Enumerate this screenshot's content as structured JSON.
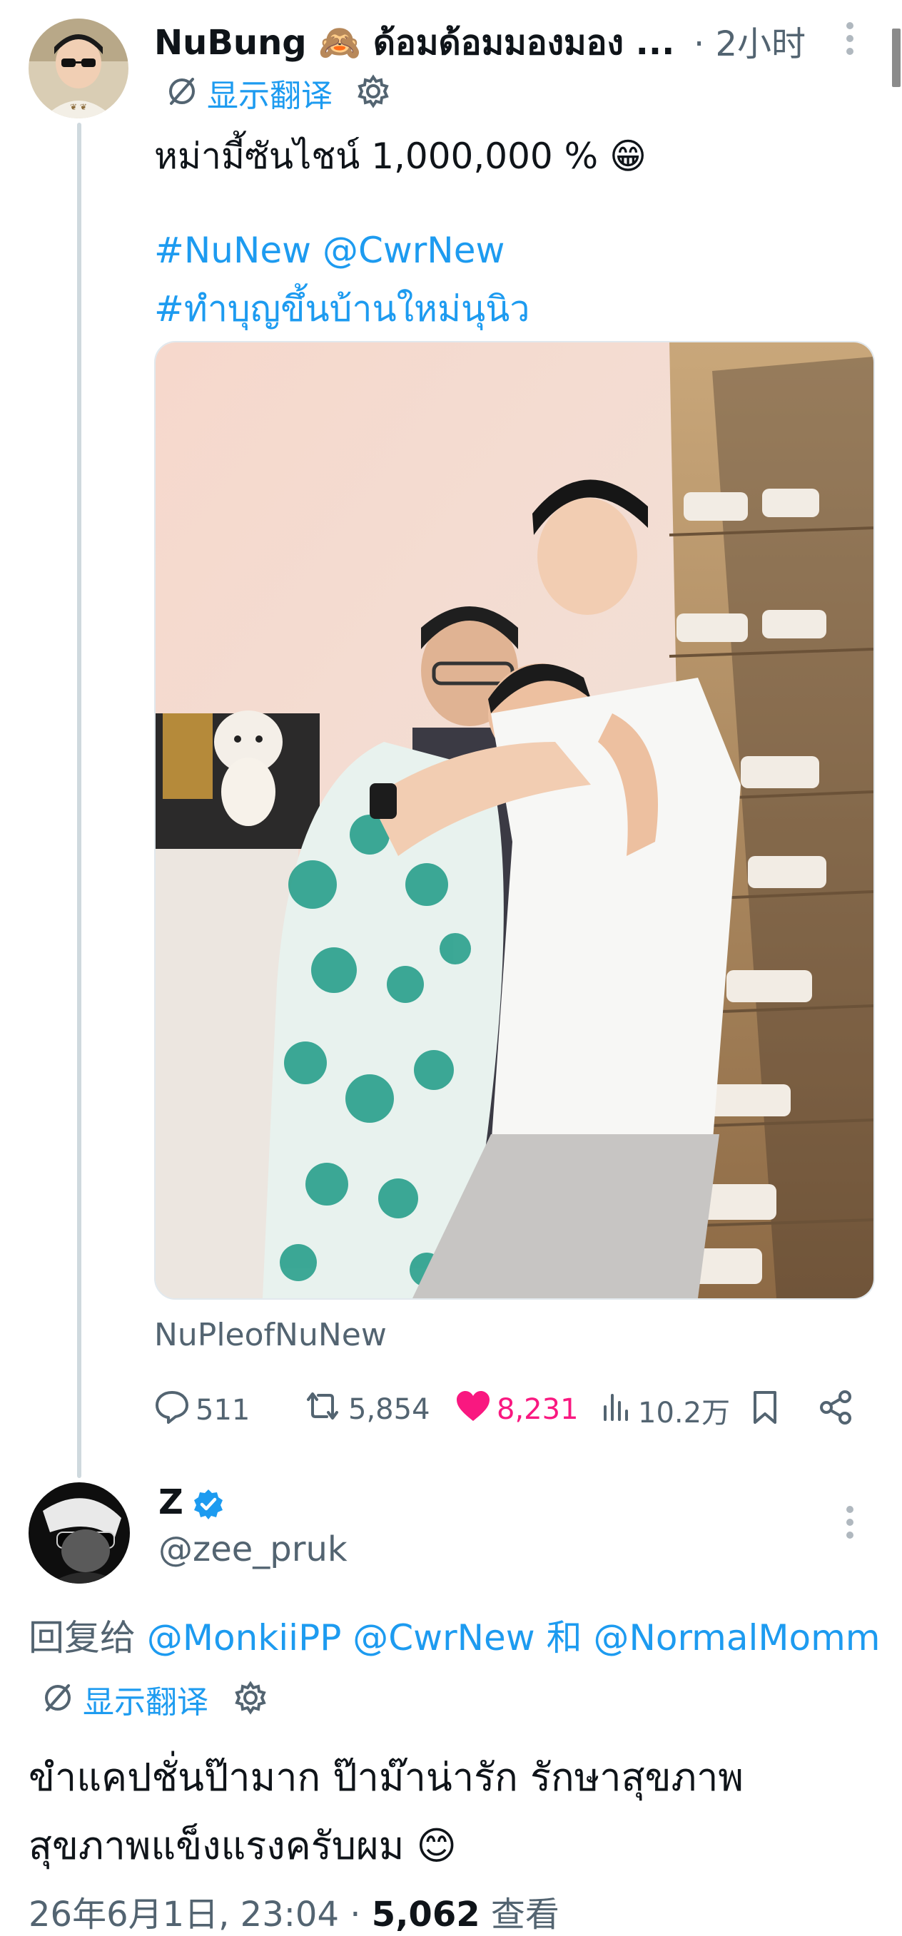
{
  "tweet": {
    "author": "NuBung 🙈 ด้อมด้อมมองมอง ...",
    "time": "· 2小时",
    "show_translation": "显示翻译",
    "text_line1": "หม่ามี้ซันไชน์ 1,000,000 % 😁",
    "hashtag_line1": "#NuNew  @CwrNew",
    "hashtag_line2": "#ทำบุญขึ้นบ้านใหม่นุนิว",
    "media_source": "NuPleofNuNew",
    "stats": {
      "replies": "511",
      "retweets": "5,854",
      "likes": "8,231",
      "views": "10.2万"
    }
  },
  "reply": {
    "name": "Z",
    "handle": "@zee_pruk",
    "reply_to_prefix": "回复给",
    "reply_to": "@MonkiiPP @CwrNew 和 @NormalMomm",
    "show_translation": "显示翻译",
    "text_line1": "ขำแคปชั่นป๊ามาก ป๊าม๊าน่ารัก รักษาสุขภาพ",
    "text_line2": "สุขภาพแข็งแรงครับผม 😊",
    "date": "26年6月1日, 23:04 ·",
    "views_count": "5,062",
    "views_label": "查看"
  },
  "colors": {
    "accent": "#1d9bf0",
    "like": "#f91880",
    "muted": "#536471"
  }
}
